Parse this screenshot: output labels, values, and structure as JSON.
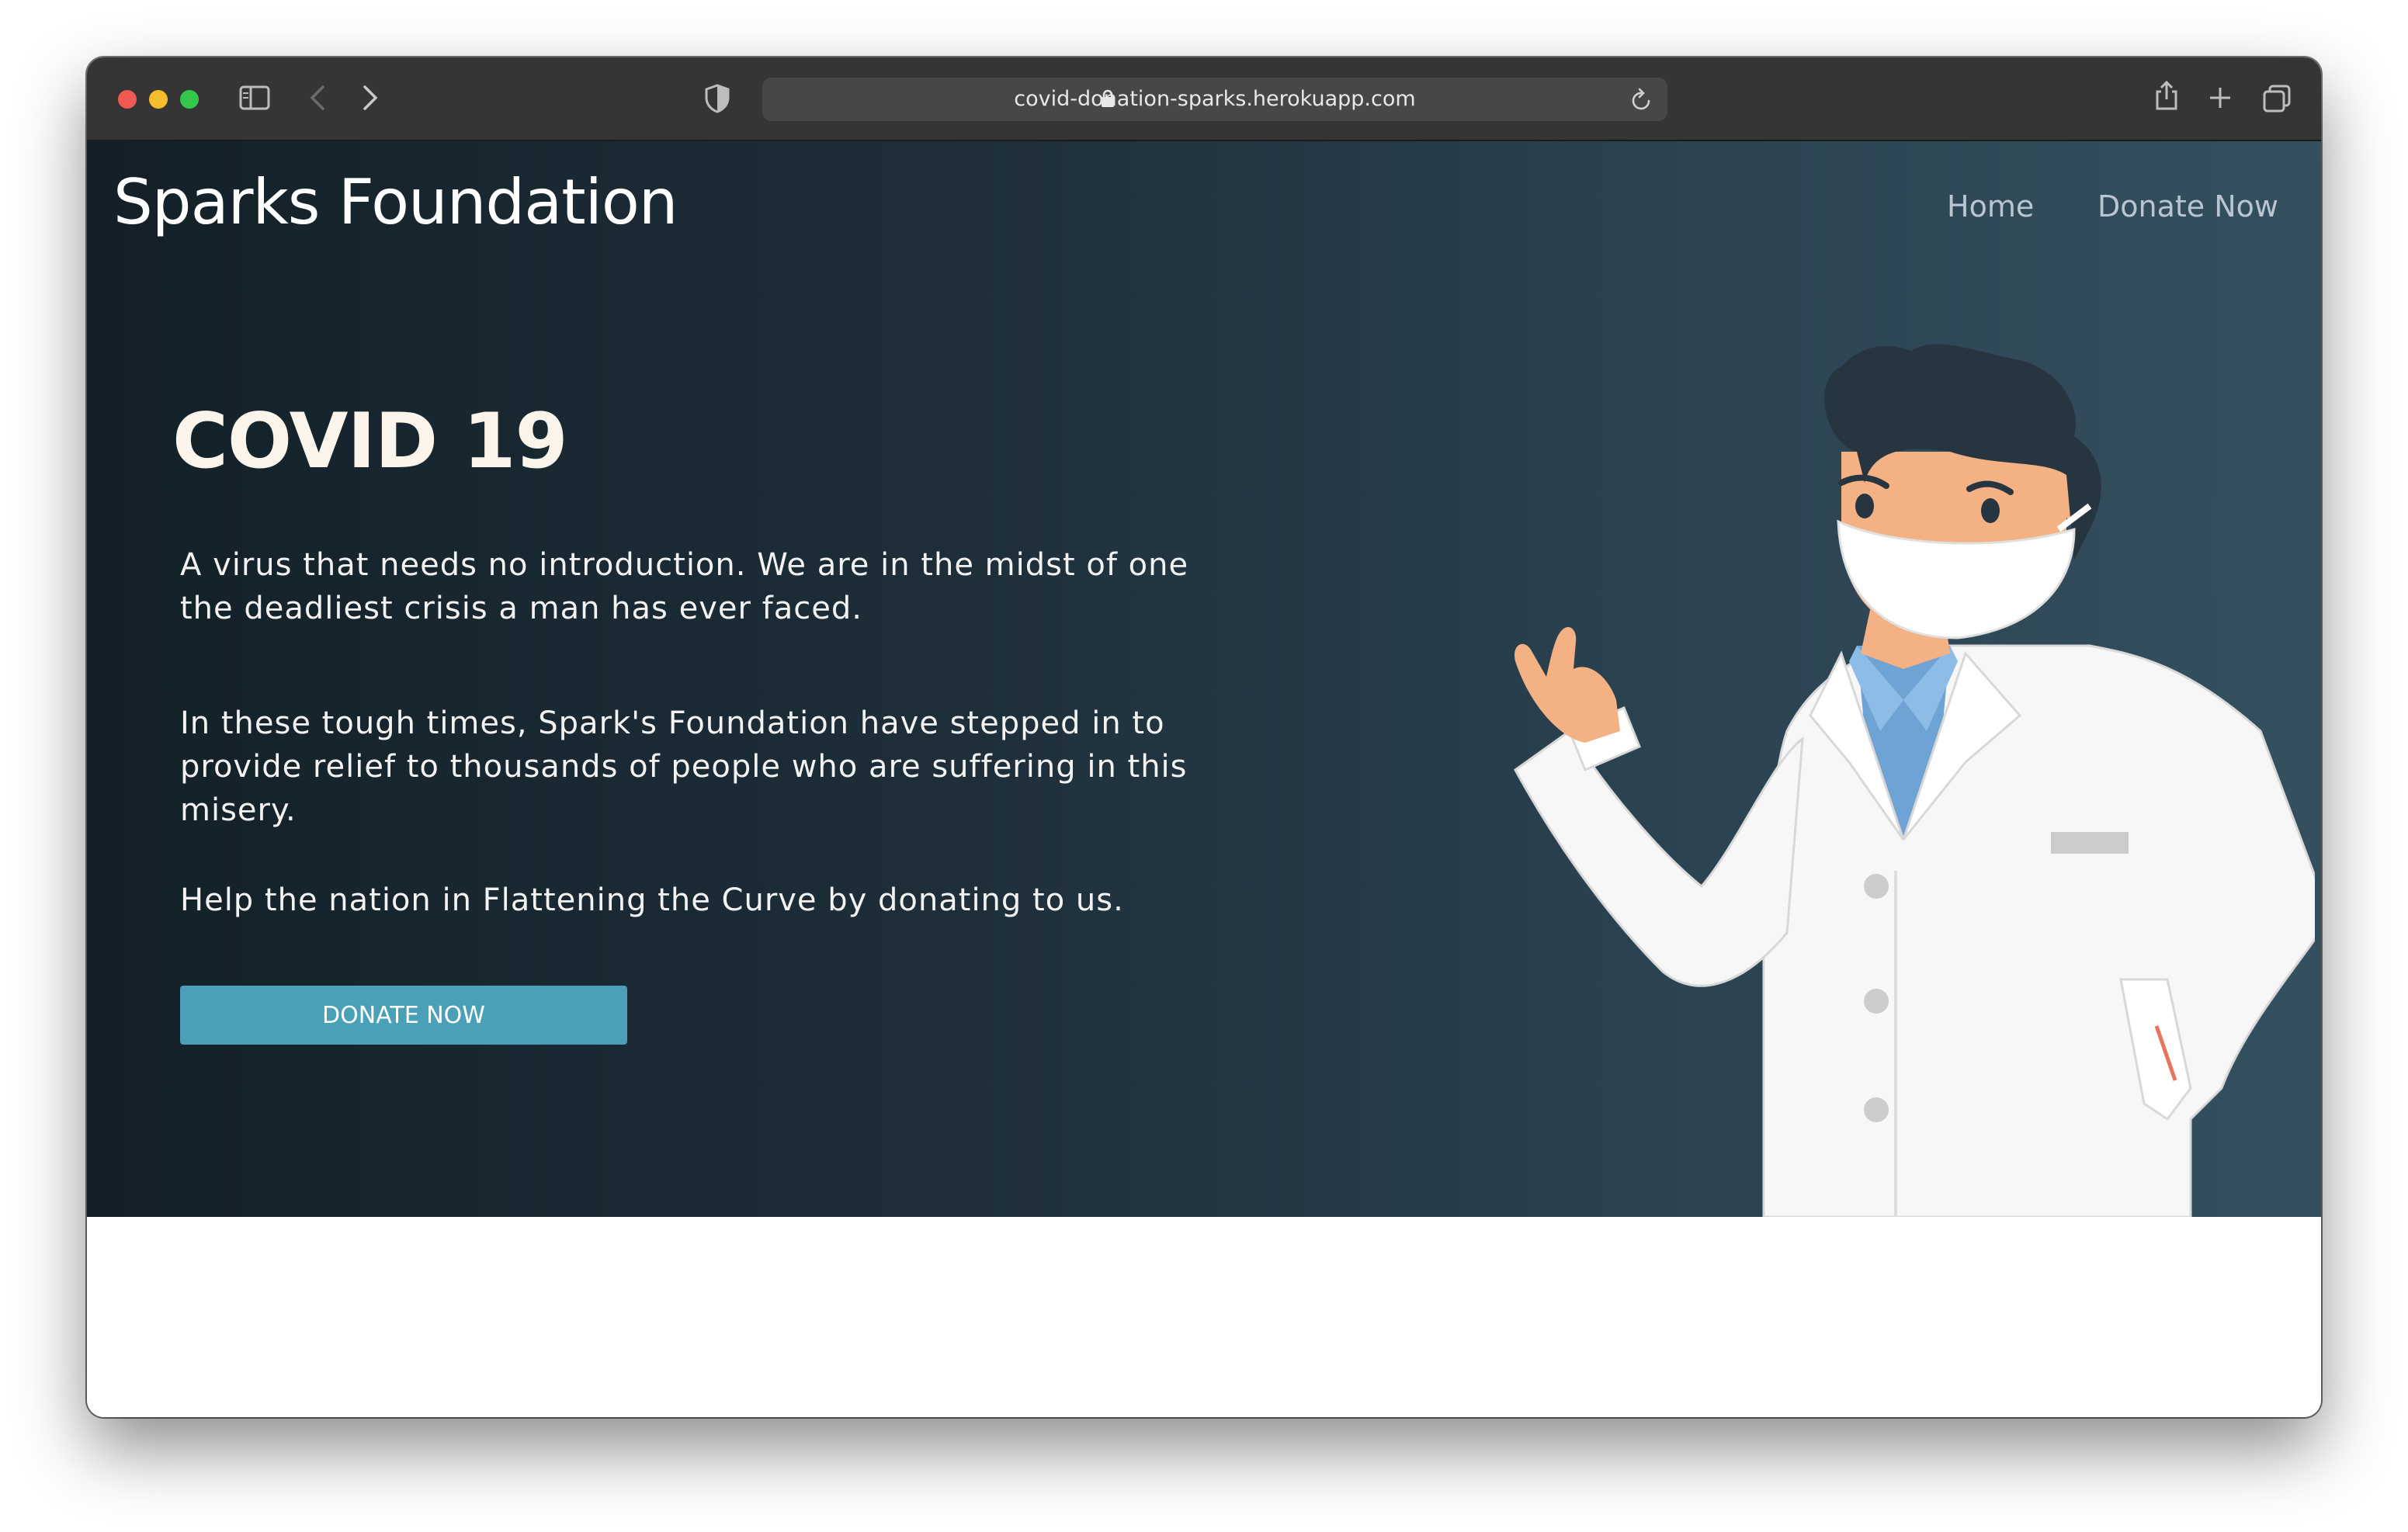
{
  "browser": {
    "url": "covid-donation-sparks.herokuapp.com"
  },
  "site": {
    "brand": "Sparks Foundation",
    "nav": {
      "home": "Home",
      "donate": "Donate Now"
    }
  },
  "hero": {
    "headline": "COVID 19",
    "paragraph_1": "A virus that needs no introduction. We are in the midst of one the deadliest crisis a man has ever faced.",
    "paragraph_2": "In these tough times, Spark's Foundation have stepped in to provide relief to thousands of people who are suffering in this misery.",
    "paragraph_3": "Help the nation in Flattening the Curve by donating to us.",
    "cta_label": "DONATE NOW"
  },
  "colors": {
    "hero_dark": "#132028",
    "hero_light": "#34505f",
    "cta": "#4aa0b7",
    "headline": "#fbf4ea"
  },
  "icons": [
    "sidebar-icon",
    "back-icon",
    "forward-icon",
    "shield-icon",
    "lock-icon",
    "reload-icon",
    "share-icon",
    "new-tab-icon",
    "tabs-overview-icon"
  ]
}
